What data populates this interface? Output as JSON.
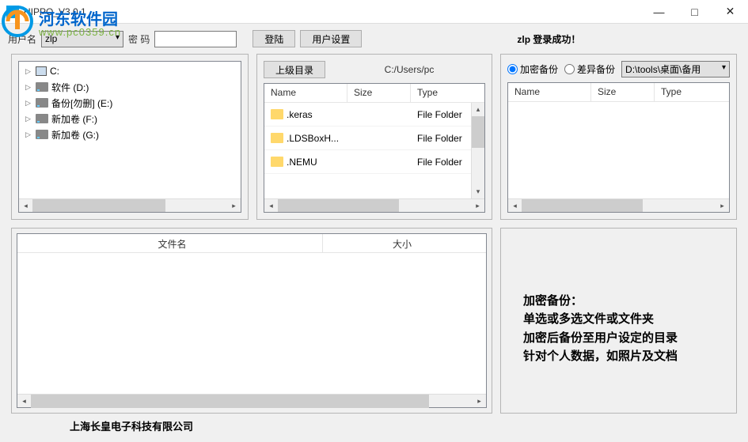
{
  "window": {
    "title": "HIPPO_V3.0.1"
  },
  "watermark": {
    "line1": "河东软件园",
    "line2": "www.pc0359.cn"
  },
  "toolbar": {
    "user_label": "用户名",
    "user_value": "zlp",
    "pw_label": "密 码",
    "pw_value": "",
    "login_label": "登陆",
    "settings_label": "用户设置",
    "status": "zlp 登录成功！"
  },
  "tree": {
    "items": [
      {
        "label": "C:",
        "icon": "pc"
      },
      {
        "label": "软件 (D:)",
        "icon": "drive"
      },
      {
        "label": "备份[勿删] (E:)",
        "icon": "drive"
      },
      {
        "label": "新加卷 (F:)",
        "icon": "drive"
      },
      {
        "label": "新加卷 (G:)",
        "icon": "drive"
      }
    ]
  },
  "browser": {
    "up_label": "上级目录",
    "path": "C:/Users/pc",
    "cols": {
      "name": "Name",
      "size": "Size",
      "type": "Type"
    },
    "rows": [
      {
        "name": ".keras",
        "size": "",
        "type": "File Folder"
      },
      {
        "name": ".LDSBoxH...",
        "size": "",
        "type": "File Folder"
      },
      {
        "name": ".NEMU",
        "size": "",
        "type": "File Folder"
      }
    ]
  },
  "backup": {
    "mode_enc": "加密备份",
    "mode_diff": "差异备份",
    "dest": "D:\\tools\\桌面\\备用",
    "cols": {
      "name": "Name",
      "size": "Size",
      "type": "Type"
    }
  },
  "queue": {
    "cols": {
      "filename": "文件名",
      "size": "大小"
    }
  },
  "info": {
    "line1": "加密备份：",
    "line2": "单选或多选文件或文件夹",
    "line3": "加密后备份至用户设定的目录",
    "line4": "针对个人数据，如照片及文档"
  },
  "footer": {
    "company": "上海长皇电子科技有限公司"
  }
}
